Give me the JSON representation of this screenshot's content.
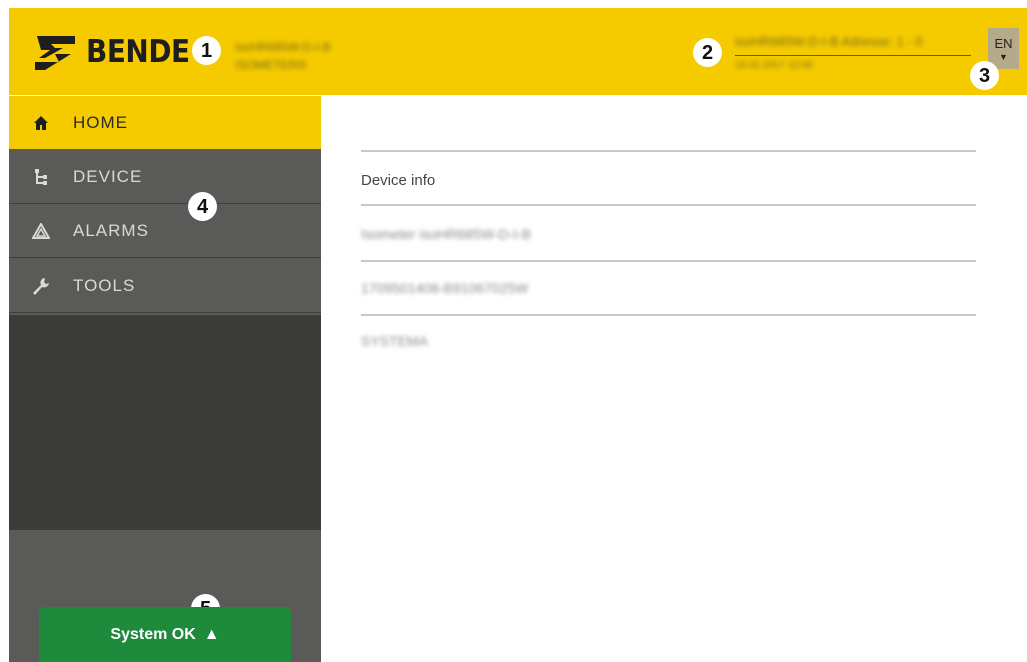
{
  "header": {
    "logo_text": "BENDE",
    "device_name": "isoHR685W-D-I-B",
    "device_type": "ISOMETER®",
    "device_address": "isoHR685W-D-I-B Adresse: 1 - 0",
    "device_time": "16.01.2017 12:00",
    "language": "EN",
    "colors": {
      "header_bg": "#f5cb00",
      "sidebar_bg": "#5a5a58",
      "status_ok": "#1e8a3c"
    }
  },
  "badges": [
    "1",
    "2",
    "3",
    "4",
    "5"
  ],
  "nav": {
    "items": [
      {
        "label": "HOME",
        "icon": "home-icon"
      },
      {
        "label": "DEVICE",
        "icon": "tree-icon"
      },
      {
        "label": "ALARMS",
        "icon": "warning-icon"
      },
      {
        "label": "TOOLS",
        "icon": "wrench-icon"
      }
    ]
  },
  "status": {
    "label": "System OK",
    "icon": "triangle-up-icon"
  },
  "main": {
    "section_title": "Device info",
    "rows": [
      "Isometer isoHR685W-D-I-B",
      "1709501408-B91067025W",
      "SYSTEMA"
    ]
  }
}
